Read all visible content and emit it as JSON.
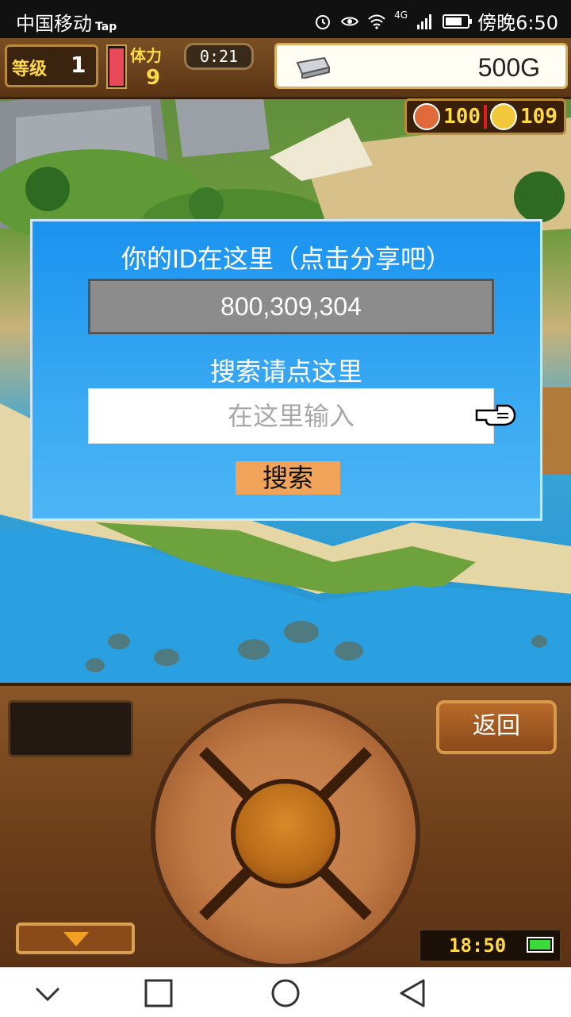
{
  "status_bar": {
    "carrier": "中国移动",
    "carrier_badge": "Tap",
    "network": "4G",
    "time": "傍晚6:50",
    "icons": [
      "alarm-icon",
      "eye-icon",
      "wifi-icon",
      "signal-icon",
      "battery-icon"
    ]
  },
  "hud": {
    "level_label": "等级",
    "level_value": "1",
    "stamina_label": "体力",
    "stamina_value": "9",
    "timer": "0:21",
    "gold": "500G",
    "meat_count": "100",
    "coin_count": "109"
  },
  "dialog": {
    "title": "你的ID在这里（点击分享吧）",
    "user_id": "800,309,304",
    "search_label": "搜索请点这里",
    "search_placeholder": "在这里输入",
    "search_button": "搜索"
  },
  "panel": {
    "back_button": "返回",
    "clock": "18:50"
  },
  "colors": {
    "dialog_blue": "#1a93ef",
    "search_button": "#f2a35a",
    "hud_yellow": "#ffd84a",
    "panel_wood": "#6a3c18"
  }
}
